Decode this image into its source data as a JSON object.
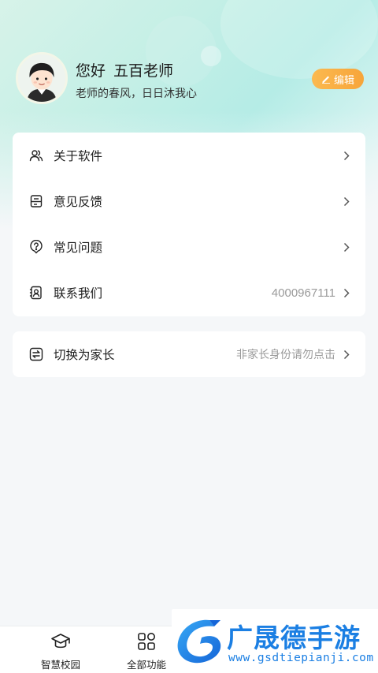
{
  "profile": {
    "greeting": "您好",
    "name": "五百老师",
    "motto": "老师的春风，日日沐我心",
    "edit_label": "编辑"
  },
  "menu": {
    "items": [
      {
        "label": "关于软件",
        "icon": "users-icon",
        "value": ""
      },
      {
        "label": "意见反馈",
        "icon": "feedback-icon",
        "value": ""
      },
      {
        "label": "常见问题",
        "icon": "question-icon",
        "value": ""
      },
      {
        "label": "联系我们",
        "icon": "contact-icon",
        "value": "4000967111"
      }
    ],
    "switch": {
      "label": "切换为家长",
      "icon": "switch-icon",
      "value": "非家长身份请勿点击"
    }
  },
  "bottom_nav": {
    "tabs": [
      {
        "label": "智慧校园",
        "icon": "graduation-cap-icon"
      },
      {
        "label": "全部功能",
        "icon": "grid-apps-icon"
      }
    ]
  },
  "watermark": {
    "title": "广晟德手游",
    "url": "www.gsdtiepianji.com"
  },
  "colors": {
    "accent_orange": "#f7a53a",
    "watermark_blue": "#1b7fe3",
    "header_mint": "#b5ece6"
  }
}
